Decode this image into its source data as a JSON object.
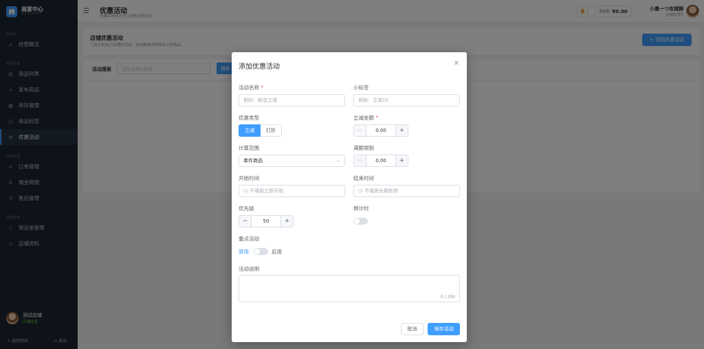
{
  "brand": {
    "title": "商家中心",
    "subtitle": "MERCHANT"
  },
  "sidebar": {
    "groups": [
      {
        "label": "控制台",
        "items": [
          {
            "label": "经营概览",
            "icon": "home-icon"
          }
        ]
      },
      {
        "label": "商品管理",
        "items": [
          {
            "label": "商品列表",
            "icon": "list-icon"
          },
          {
            "label": "发布商品",
            "icon": "plus-icon"
          },
          {
            "label": "库存管理",
            "icon": "box-icon"
          },
          {
            "label": "商品标签",
            "icon": "tag-icon"
          },
          {
            "label": "优惠活动",
            "icon": "gift-icon",
            "active": true
          }
        ]
      },
      {
        "label": "交易管理",
        "items": [
          {
            "label": "订单管理",
            "icon": "order-icon"
          },
          {
            "label": "佣金明细",
            "icon": "commission-icon"
          },
          {
            "label": "售后管理",
            "icon": "aftersale-icon"
          }
        ]
      },
      {
        "label": "店铺管理",
        "items": [
          {
            "label": "保证金管理",
            "icon": "deposit-icon"
          },
          {
            "label": "店铺资料",
            "icon": "store-icon"
          }
        ]
      }
    ],
    "user": {
      "name": "测试店铺",
      "status": "店铺运营"
    },
    "footer": {
      "back": "返回网站",
      "logout": "退出"
    }
  },
  "topbar": {
    "title": "优惠活动",
    "subtitle": "创建店铺自己的立减和打折活动",
    "deposit_label": "保证金",
    "deposit_value": "¥0.00",
    "user_name": "小墨一つ攻城狮",
    "user_role": "店铺管理员"
  },
  "content": {
    "title": "店铺优惠活动",
    "subtitle": "只显示你自己店铺的活动，支持精确选择你自己的商品。",
    "add_button": "添加优惠活动",
    "filter_label": "活动搜索",
    "filter_placeholder": "活动名称/说明",
    "filter_button": "搜索"
  },
  "dialog": {
    "title": "添加优惠活动",
    "name_label": "活动名称",
    "name_placeholder": "例如：新店立减",
    "tag_label": "小标签",
    "tag_placeholder": "例如：立减10",
    "type_label": "优惠类型",
    "type_options": [
      "立减",
      "打折"
    ],
    "type_selected": "立减",
    "amount_label": "立减金额",
    "amount_value": "0.00",
    "scope_label": "计算范围",
    "scope_value": "单件商品",
    "threshold_label": "满额限制",
    "threshold_value": "0.00",
    "start_label": "开始时间",
    "start_placeholder": "不填则立即开始",
    "end_label": "结束时间",
    "end_placeholder": "不填则长期有效",
    "priority_label": "优先级",
    "priority_value": "50",
    "countdown_label": "倒计时",
    "countdown_on": false,
    "featured_label": "重点活动",
    "featured_off_text": "禁用",
    "featured_on_text": "启用",
    "featured_on": false,
    "desc_label": "活动说明",
    "desc_count": "0 / 200",
    "cancel": "取消",
    "save": "保存活动"
  },
  "colors": {
    "primary": "#409eff",
    "sidebar_bg": "#1d2633",
    "required": "#f56c6c"
  }
}
